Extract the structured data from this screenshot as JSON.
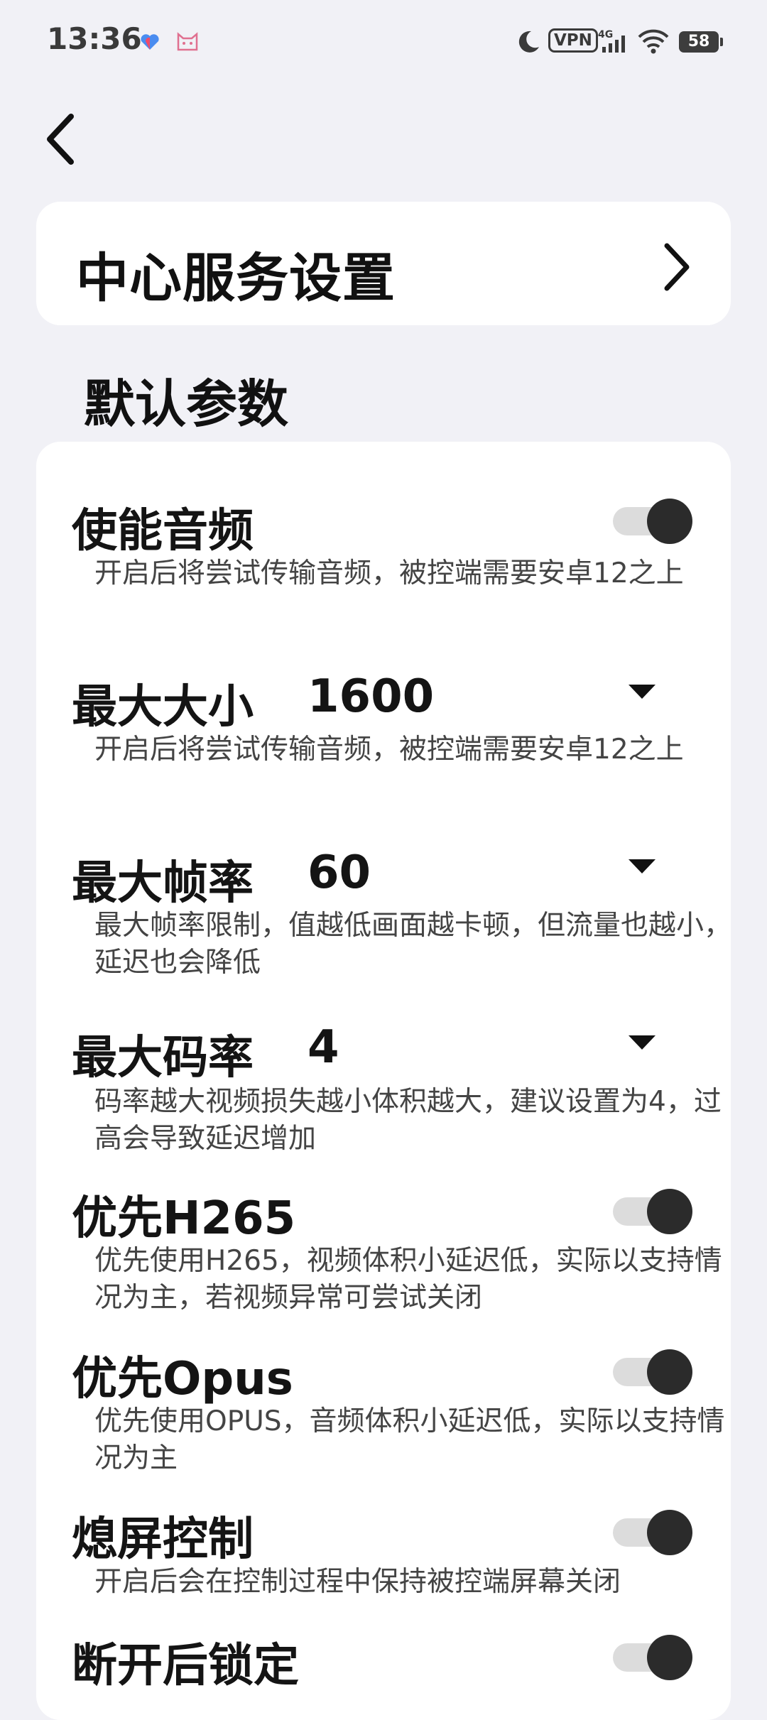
{
  "status_bar": {
    "time": "13:36",
    "vpn_label": "VPN",
    "network": "4G",
    "battery": "58"
  },
  "service_card": {
    "title": "中心服务设置"
  },
  "section_title": "默认参数",
  "settings": [
    {
      "title": "使能音频",
      "desc": "开启后将尝试传输音频，被控端需要安卓12之上",
      "control": "toggle",
      "on": true
    },
    {
      "title": "最大大小",
      "value": "1600",
      "desc": "开启后将尝试传输音频，被控端需要安卓12之上",
      "control": "dropdown"
    },
    {
      "title": "最大帧率",
      "value": "60",
      "desc": "最大帧率限制，值越低画面越卡顿，但流量也越小，延迟也会降低",
      "control": "dropdown"
    },
    {
      "title": "最大码率",
      "value": "4",
      "desc": "码率越大视频损失越小体积越大，建议设置为4，过高会导致延迟增加",
      "control": "dropdown"
    },
    {
      "title": "优先H265",
      "desc": "优先使用H265，视频体积小延迟低，实际以支持情况为主，若视频异常可尝试关闭",
      "control": "toggle",
      "on": true
    },
    {
      "title": "优先Opus",
      "desc": "优先使用OPUS，音频体积小延迟低，实际以支持情况为主",
      "control": "toggle",
      "on": true
    },
    {
      "title": "熄屏控制",
      "desc": "开启后会在控制过程中保持被控端屏幕关闭",
      "control": "toggle",
      "on": true
    },
    {
      "title": "断开后锁定",
      "control": "toggle",
      "on": true
    }
  ],
  "colors": {
    "background": "#f1f1f6",
    "card": "#ffffff",
    "toggle_knob": "#2b2b2b",
    "toggle_track": "#dcdcdc"
  },
  "icons": {
    "back": "back-arrow-icon",
    "chevron": "chevron-right-icon",
    "dropdown": "caret-down-icon"
  }
}
